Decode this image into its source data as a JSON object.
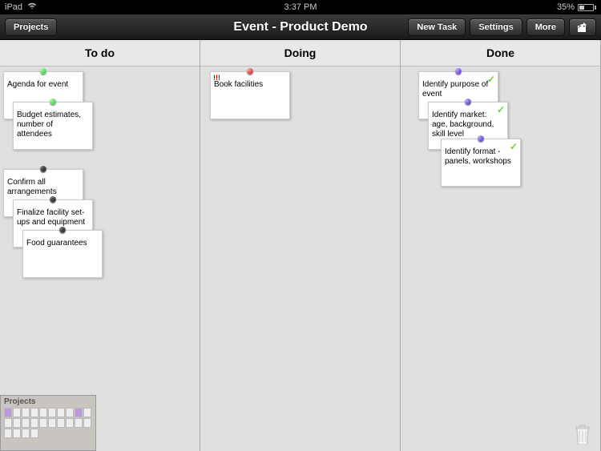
{
  "status": {
    "device": "iPad",
    "time": "3:37 PM",
    "battery_pct": "35%"
  },
  "toolbar": {
    "projects": "Projects",
    "title": "Event - Product Demo",
    "new_task": "New Task",
    "settings": "Settings",
    "more": "More"
  },
  "columns": {
    "todo": "To do",
    "doing": "Doing",
    "done": "Done"
  },
  "cards": {
    "todo": [
      {
        "text": "Agenda for event",
        "pin": "green"
      },
      {
        "text": "Budget estimates, number of attendees",
        "pin": "green"
      },
      {
        "text": "Confirm all arrangements",
        "pin": "black"
      },
      {
        "text": "Finalize facility set-ups and equipment",
        "pin": "black"
      },
      {
        "text": "Food guarantees",
        "pin": "black"
      }
    ],
    "doing": [
      {
        "text": "Book facilities",
        "pin": "red",
        "priority": "!!!"
      }
    ],
    "done": [
      {
        "text": "Identify purpose of event",
        "pin": "purple",
        "done": true
      },
      {
        "text": "Identify market: age, background, skill level",
        "pin": "purple",
        "done": true
      },
      {
        "text": "Identify format - panels, workshops",
        "pin": "purple",
        "done": true
      }
    ]
  },
  "projects_thumb": "Projects"
}
